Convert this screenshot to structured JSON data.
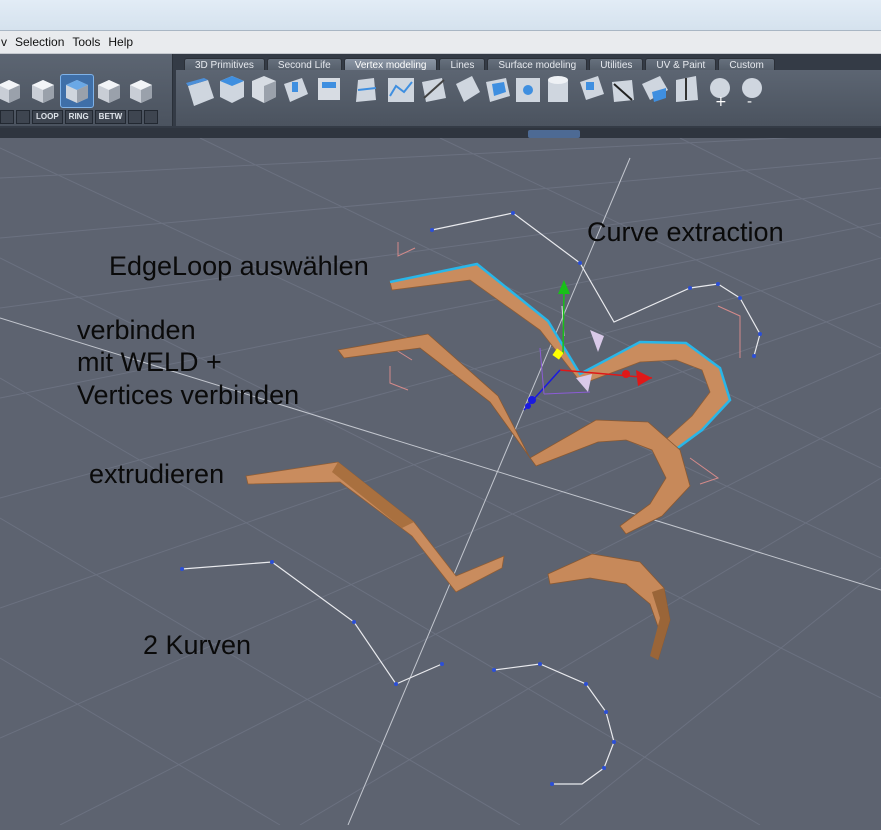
{
  "menu": {
    "items": [
      "v",
      "Selection",
      "Tools",
      "Help"
    ]
  },
  "tabs": [
    "3D Primitives",
    "Second Life",
    "Vertex modeling",
    "Lines",
    "Surface modeling",
    "Utilities",
    "UV & Paint",
    "Custom"
  ],
  "active_tab": "Vertex modeling",
  "selection_buttons": [
    "LOOP",
    "RING",
    "BETW"
  ],
  "annotations": {
    "curve_extraction": "Curve extraction",
    "edgeloop": "EdgeLoop auswählen",
    "verbinden": "verbinden\nmit WELD +\nVertices verbinden",
    "extrudieren": "extrudieren",
    "kurven": "2 Kurven"
  },
  "colors": {
    "viewport_bg": "#5d6370",
    "grid": "#6b7180",
    "ribbon": "#c98c5e",
    "selected_edge": "#29b6e8",
    "gizmo_x": "#e01818",
    "gizmo_y": "#18c018",
    "gizmo_z": "#1a1ae0"
  },
  "icons": [
    "cube-vertex-icon",
    "cube-edge-icon",
    "cube-face-icon",
    "cube-object-icon",
    "cube-select-icon"
  ]
}
